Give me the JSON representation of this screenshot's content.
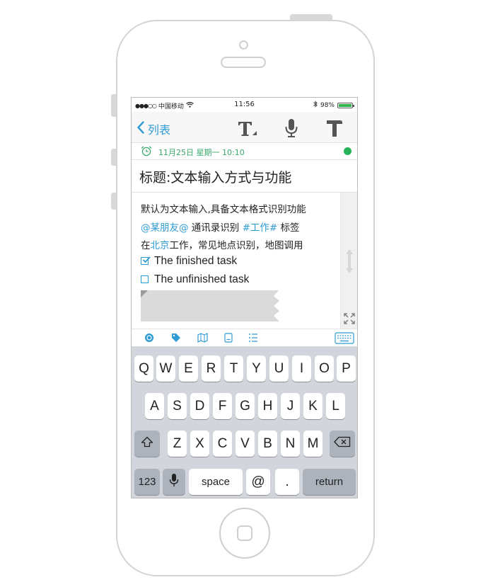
{
  "status_bar": {
    "signal": "●●●○○",
    "carrier": "中国移动",
    "time": "11:56",
    "battery_pct": "98%",
    "battery_level": 0.98,
    "battery_color": "#2fb34a"
  },
  "nav": {
    "back_label": "列表",
    "icons": [
      "text-format-icon",
      "microphone-icon",
      "hammer-icon"
    ]
  },
  "reminder": {
    "date_text": "11月25日 星期一  10:10",
    "status_color": "#26b35a"
  },
  "note": {
    "title": "标题:文本输入方式与功能",
    "line1": "默认为文本输入,具备文本格式识别功能",
    "mention": "@某朋友@",
    "contacts_text": " 通讯录识别 ",
    "hashtag": "#工作#",
    "tag_text": " 标签",
    "line3_prefix": "在",
    "place": "北京",
    "line3_suffix": "工作，常见地点识别，地图调用",
    "task_done": "The finished task",
    "task_todo": "The unfinished task"
  },
  "toolbar": {
    "icons": [
      "emoji-icon",
      "tag-icon",
      "map-icon",
      "document-icon",
      "checklist-icon",
      "keyboard-icon"
    ]
  },
  "keyboard": {
    "row1": [
      "Q",
      "W",
      "E",
      "R",
      "T",
      "Y",
      "U",
      "I",
      "O",
      "P"
    ],
    "row2": [
      "A",
      "S",
      "D",
      "F",
      "G",
      "H",
      "J",
      "K",
      "L"
    ],
    "row3": [
      "Z",
      "X",
      "C",
      "V",
      "B",
      "N",
      "M"
    ],
    "numbers_key": "123",
    "space_key": "space",
    "at_key": "@",
    "dot_key": ".",
    "return_key": "return"
  },
  "colors": {
    "accent": "#2f9bd3",
    "date_green": "#3aa86c"
  }
}
